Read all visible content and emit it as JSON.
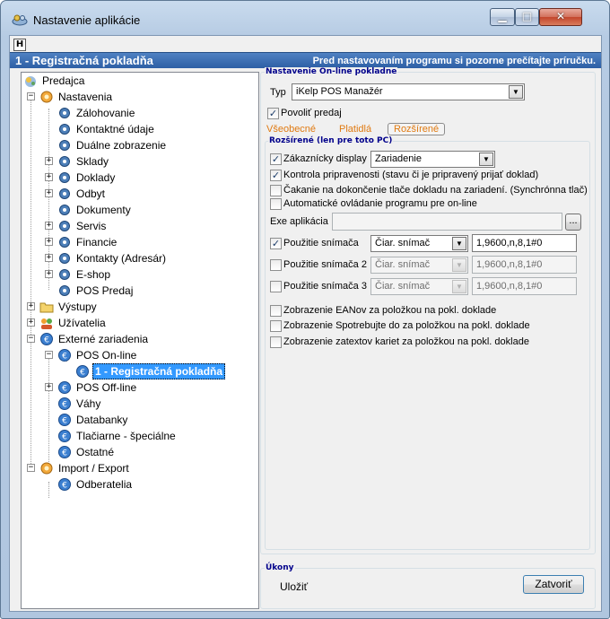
{
  "window": {
    "title": "Nastavenie aplikácie"
  },
  "banner": {
    "h_label": "H",
    "title": "1 - Registračná pokladňa",
    "note": "Pred nastavovaním programu si pozorne prečítajte príručku."
  },
  "tree": {
    "root": "Predajca",
    "nastavenia": "Nastavenia",
    "nastavenia_children": [
      "Zálohovanie",
      "Kontaktné údaje",
      "Duálne zobrazenie",
      "Sklady",
      "Doklady",
      "Odbyt",
      "Dokumenty",
      "Servis",
      "Financie",
      "Kontakty (Adresár)",
      "E-shop",
      "POS Predaj"
    ],
    "vystupy": "Výstupy",
    "uzivatelia": "Užívatelia",
    "externe": "Externé zariadenia",
    "pos_online": "POS On-line",
    "selected": "1 - Registračná pokladňa",
    "pos_offline": "POS Off-line",
    "vahy": "Váhy",
    "databanky": "Databanky",
    "tlaciarne": "Tlačiarne - špeciálne",
    "ostatne": "Ostatné",
    "import_export": "Import / Export",
    "odberatelia": "Odberatelia"
  },
  "online": {
    "group_title": "Nastavenie On-line pokladne",
    "typ_label": "Typ",
    "typ_value": "iKelp POS Manažér",
    "povolit_label": "Povoliť predaj",
    "povolit_checked": true,
    "tabs": [
      "Všeobecné",
      "Platidlá",
      "Rozšírené"
    ],
    "active_tab": "Rozšírené"
  },
  "extended": {
    "group_title": "Rozšírené (len pre toto PC)",
    "display_label": "Zákaznícky display",
    "display_checked": true,
    "display_value": "Zariadenie",
    "options": [
      {
        "label": "Kontrola pripravenosti (stavu či je pripravený prijať doklad)",
        "checked": true
      },
      {
        "label": "Čakanie na dokončenie tlače dokladu na zariadení. (Synchrónna tlač)",
        "checked": false
      },
      {
        "label": "Automatické ovládanie programu pre on-line",
        "checked": false
      }
    ],
    "exe_label": "Exe aplikácia",
    "exe_value": "",
    "browse_label": "...",
    "scanners": [
      {
        "label": "Použitie snímača",
        "checked": true,
        "type": "Čiar. snímač",
        "params": "1,9600,n,8,1#0",
        "enabled": true
      },
      {
        "label": "Použitie snímača 2",
        "checked": false,
        "type": "Čiar. snímač",
        "params": "1,9600,n,8,1#0",
        "enabled": false
      },
      {
        "label": "Použitie snímača 3",
        "checked": false,
        "type": "Čiar. snímač",
        "params": "1,9600,n,8,1#0",
        "enabled": false
      }
    ],
    "bottom_options": [
      {
        "label": "Zobrazenie EANov za položkou na pokl. doklade",
        "checked": false
      },
      {
        "label": "Zobrazenie Spotrebujte do za položkou na pokl. doklade",
        "checked": false
      },
      {
        "label": "Zobrazenie zatextov kariet za položkou na pokl. doklade",
        "checked": false
      }
    ]
  },
  "actions": {
    "group_title": "Úkony",
    "save_label": "Uložiť",
    "close_label": "Zatvoriť"
  },
  "colors": {
    "banner": "#2d5fa5",
    "tab_link": "#e07a12",
    "selection": "#3399ff"
  }
}
